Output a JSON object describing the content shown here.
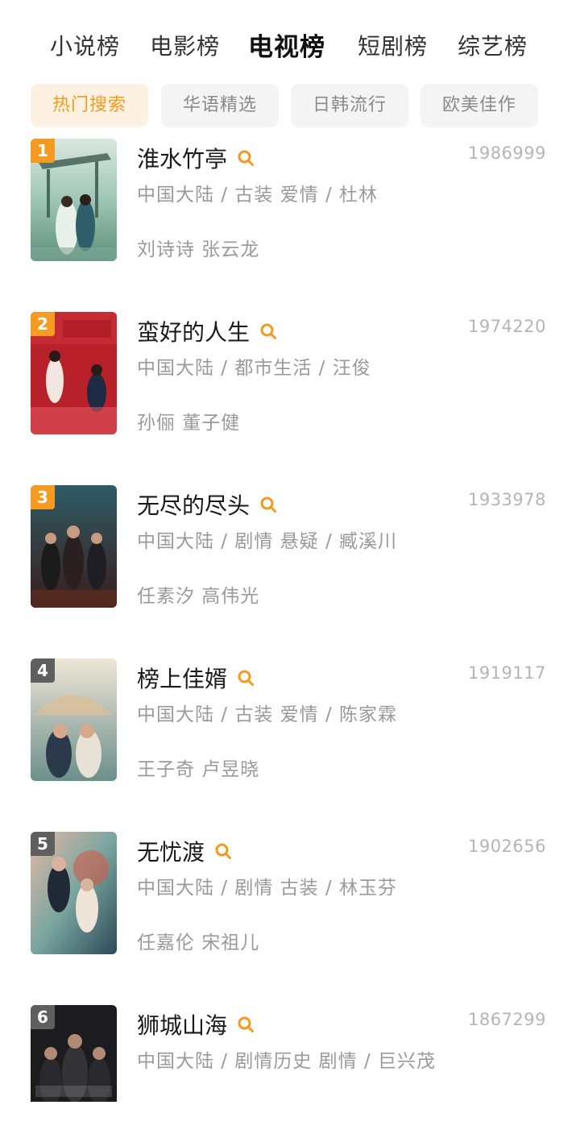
{
  "top_tabs": [
    {
      "label": "小说榜",
      "active": false
    },
    {
      "label": "电影榜",
      "active": false
    },
    {
      "label": "电视榜",
      "active": true
    },
    {
      "label": "短剧榜",
      "active": false
    },
    {
      "label": "综艺榜",
      "active": false
    }
  ],
  "chips": [
    {
      "label": "热门搜索",
      "active": true
    },
    {
      "label": "华语精选",
      "active": false
    },
    {
      "label": "日韩流行",
      "active": false
    },
    {
      "label": "欧美佳作",
      "active": false
    }
  ],
  "colors": {
    "accent": "#f29a1f",
    "rank_1": "#f59a23",
    "rank_2": "#f59a23",
    "rank_3": "#f59a23",
    "rank_other": "#5f5f5f"
  },
  "items": [
    {
      "rank": "1",
      "title": "淮水竹亭",
      "count": "1986999",
      "meta": "中国大陆 / 古装 爱情 / 杜林",
      "cast": "刘诗诗 张云龙"
    },
    {
      "rank": "2",
      "title": "蛮好的人生",
      "count": "1974220",
      "meta": "中国大陆 / 都市生活 / 汪俊",
      "cast": "孙俪 董子健"
    },
    {
      "rank": "3",
      "title": "无尽的尽头",
      "count": "1933978",
      "meta": "中国大陆 / 剧情 悬疑 / 臧溪川",
      "cast": "任素汐 高伟光"
    },
    {
      "rank": "4",
      "title": "榜上佳婿",
      "count": "1919117",
      "meta": "中国大陆 / 古装 爱情 / 陈家霖",
      "cast": "王子奇 卢昱晓"
    },
    {
      "rank": "5",
      "title": "无忧渡",
      "count": "1902656",
      "meta": "中国大陆 / 剧情 古装 / 林玉芬",
      "cast": "任嘉伦 宋祖儿"
    },
    {
      "rank": "6",
      "title": "狮城山海",
      "count": "1867299",
      "meta": "中国大陆 / 剧情历史 剧情 / 巨兴茂",
      "cast": ""
    }
  ]
}
